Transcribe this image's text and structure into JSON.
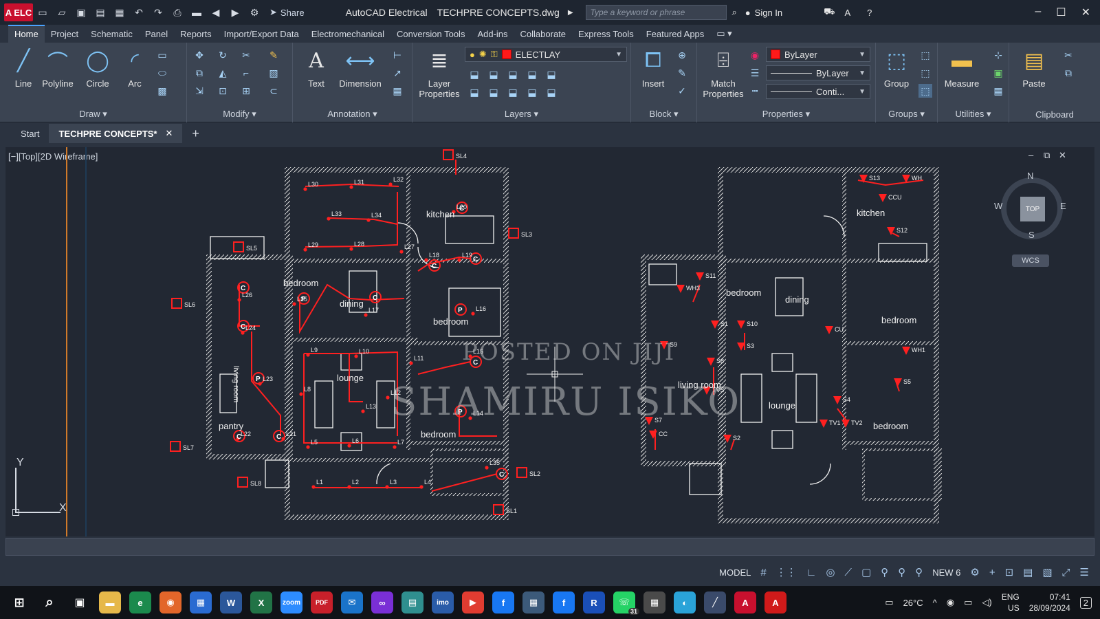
{
  "titlebar": {
    "logo": "A ELC",
    "share_label": "Share",
    "app_title": "AutoCAD Electrical",
    "file_name": "TECHPRE CONCEPTS.dwg",
    "search_placeholder": "Type a keyword or phrase",
    "signin_label": "Sign In"
  },
  "menu": {
    "tabs": [
      "Home",
      "Project",
      "Schematic",
      "Panel",
      "Reports",
      "Import/Export Data",
      "Electromechanical",
      "Conversion Tools",
      "Add-ins",
      "Collaborate",
      "Express Tools",
      "Featured Apps"
    ]
  },
  "ribbon": {
    "draw": {
      "title": "Draw",
      "tools": [
        "Line",
        "Polyline",
        "Circle",
        "Arc"
      ]
    },
    "modify": {
      "title": "Modify"
    },
    "annotation": {
      "title": "Annotation",
      "tools": [
        "Text",
        "Dimension"
      ]
    },
    "layers": {
      "title": "Layers",
      "layer_properties": "Layer Properties",
      "current_layer": "ELECTLAY"
    },
    "block": {
      "title": "Block",
      "insert": "Insert"
    },
    "properties": {
      "title": "Properties",
      "match": "Match Properties",
      "color": "ByLayer",
      "lineweight": "ByLayer",
      "linetype": "Conti..."
    },
    "groups": {
      "title": "Groups",
      "group": "Group"
    },
    "utilities": {
      "title": "Utilities",
      "measure": "Measure"
    },
    "clipboard": {
      "title": "Clipboard",
      "paste": "Paste"
    }
  },
  "doctabs": {
    "start": "Start",
    "active": "TECHPRE CONCEPTS*"
  },
  "viewport": {
    "label": "[−][Top][2D Wireframe]",
    "compass": {
      "n": "N",
      "s": "S",
      "e": "E",
      "w": "W",
      "top": "TOP"
    },
    "wcs": "WCS",
    "axis_y": "Y",
    "axis_x": "X",
    "watermark1": "POSTED ON JIJI",
    "watermark2": "SHAMIRU ISIKO"
  },
  "plan_left": {
    "rooms": [
      "kitchen",
      "bedroom",
      "dining",
      "bedroom",
      "lounge",
      "living room",
      "pantry",
      "bedroom"
    ],
    "lights": [
      "L30",
      "L31",
      "L32",
      "L33",
      "L34",
      "L29",
      "L28",
      "L27",
      "L20",
      "L18",
      "L19",
      "L16",
      "L26",
      "L25",
      "L24",
      "L17",
      "L15",
      "L11",
      "L10",
      "L9",
      "L8",
      "L13",
      "L12",
      "L23",
      "L22",
      "L21",
      "L14",
      "L6",
      "L5",
      "L7",
      "L1",
      "L2",
      "L3",
      "L4",
      "L35"
    ],
    "switches": [
      "SL4",
      "SL3",
      "SL5",
      "SL6",
      "SL7",
      "SL8",
      "SL2",
      "SL1"
    ]
  },
  "plan_right": {
    "rooms": [
      "kitchen",
      "bedroom",
      "dining",
      "bedroom",
      "living room",
      "lounge",
      "bedroom"
    ],
    "sockets": [
      "S13",
      "WH",
      "CCU",
      "S12",
      "S11",
      "WH3",
      "S10",
      "S9",
      "S3",
      "S8",
      "TVS",
      "CU",
      "WH1",
      "S5",
      "S4",
      "TV1",
      "TV2",
      "S7",
      "S2",
      "S1",
      "CC"
    ]
  },
  "statusbar": {
    "model": "MODEL",
    "annoscale": "NEW 6"
  },
  "taskbar": {
    "temperature": "26°C",
    "lang1": "ENG",
    "lang2": "US",
    "time": "07:41",
    "date": "28/09/2024",
    "notifications": "2",
    "whatsapp_badge": "31"
  }
}
